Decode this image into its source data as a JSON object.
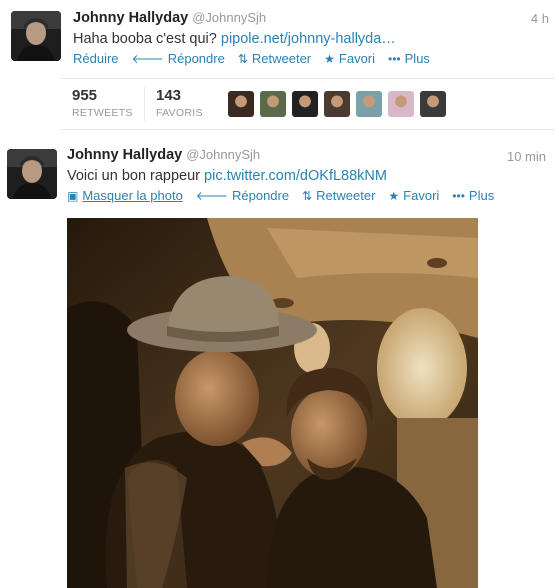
{
  "tweet1": {
    "name": "Johnny Hallyday",
    "handle": "@JohnnySjh",
    "time": "4 h",
    "text_prefix": "Haha booba c'est qui? ",
    "link": "pipole.net/johnny-hallyda…",
    "actions": {
      "collapse": "Réduire",
      "reply": "Répondre",
      "retweet": "Retweeter",
      "favorite": "Favori",
      "more": "Plus"
    },
    "stats": {
      "retweets_count": "955",
      "retweets_label": "RETWEETS",
      "favorites_count": "143",
      "favorites_label": "FAVORIS"
    },
    "favoriter_avatars": [
      "#3a2a22",
      "#5a6a4a",
      "#222222",
      "#4a3a30",
      "#7aa0a8",
      "#d8b8c8",
      "#3a3a3a"
    ]
  },
  "tweet2": {
    "name": "Johnny Hallyday",
    "handle": "@JohnnySjh",
    "time": "10 min",
    "text_prefix": "Voici un bon rappeur ",
    "link": "pic.twitter.com/dOKfL88kNM",
    "actions": {
      "hide_photo": "Masquer la photo",
      "reply": "Répondre",
      "retweet": "Retweeter",
      "favorite": "Favori",
      "more": "Plus"
    }
  },
  "colors": {
    "link": "#2a83b3",
    "muted": "#999999",
    "text": "#333333"
  },
  "icons": {
    "reply": "reply-arrow-icon",
    "retweet": "retweet-icon",
    "favorite": "star-icon",
    "more": "ellipsis-icon",
    "photo": "photo-icon"
  }
}
